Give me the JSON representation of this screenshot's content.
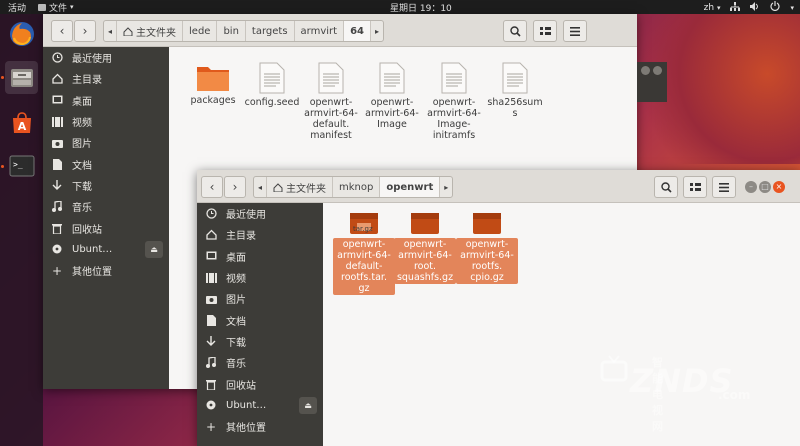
{
  "topbar": {
    "activities": "活动",
    "app_menu": "文件",
    "clock": "星期日 19：10",
    "lang": "zh"
  },
  "dock": {
    "items": [
      "firefox-icon",
      "files-icon",
      "software-icon",
      "terminal-icon"
    ]
  },
  "window1": {
    "breadcrumbs": [
      "主文件夹",
      "lede",
      "bin",
      "targets",
      "armvirt",
      "64"
    ],
    "sidebar": [
      {
        "label": "最近使用",
        "icon": "clock-icon"
      },
      {
        "label": "主目录",
        "icon": "home-icon"
      },
      {
        "label": "桌面",
        "icon": "desktop-icon"
      },
      {
        "label": "视频",
        "icon": "video-icon"
      },
      {
        "label": "图片",
        "icon": "camera-icon"
      },
      {
        "label": "文档",
        "icon": "document-icon"
      },
      {
        "label": "下载",
        "icon": "download-icon"
      },
      {
        "label": "音乐",
        "icon": "music-icon"
      },
      {
        "label": "回收站",
        "icon": "trash-icon"
      },
      {
        "label": "Ubunt…",
        "icon": "disk-icon"
      },
      {
        "label": "其他位置",
        "icon": "plus-icon"
      }
    ],
    "files": [
      {
        "name": "packages",
        "type": "folder"
      },
      {
        "name": "config.seed",
        "type": "text"
      },
      {
        "name": "openwrt-\narmvirt-64-\ndefault.\nmanifest",
        "type": "text"
      },
      {
        "name": "openwrt-\narmvirt-64-\nImage",
        "type": "text"
      },
      {
        "name": "openwrt-\narmvirt-64-\nImage-\ninitramfs",
        "type": "text"
      },
      {
        "name": "sha256sum\ns",
        "type": "text"
      }
    ]
  },
  "window2": {
    "breadcrumbs": [
      "主文件夹",
      "mknop",
      "openwrt"
    ],
    "sidebar": [
      {
        "label": "最近使用",
        "icon": "clock-icon"
      },
      {
        "label": "主目录",
        "icon": "home-icon"
      },
      {
        "label": "桌面",
        "icon": "desktop-icon"
      },
      {
        "label": "视频",
        "icon": "video-icon"
      },
      {
        "label": "图片",
        "icon": "camera-icon"
      },
      {
        "label": "文档",
        "icon": "document-icon"
      },
      {
        "label": "下载",
        "icon": "download-icon"
      },
      {
        "label": "音乐",
        "icon": "music-icon"
      },
      {
        "label": "回收站",
        "icon": "trash-icon"
      },
      {
        "label": "Ubunt…",
        "icon": "disk-icon"
      },
      {
        "label": "其他位置",
        "icon": "plus-icon"
      }
    ],
    "files": [
      {
        "name": "openwrt-\narmvirt-64-\ndefault-\nrootfs.tar.\ngz",
        "badge": "tar.gz"
      },
      {
        "name": "openwrt-\narmvirt-64-\nroot.\nsquashfs.gz",
        "badge": ""
      },
      {
        "name": "openwrt-\narmvirt-64-\nrootfs.\ncpio.gz",
        "badge": ""
      }
    ]
  },
  "watermark": {
    "brand": "ZNDS",
    "cn": "智能电视网",
    "domain": ".com"
  },
  "colors": {
    "accent": "#e95420",
    "sidebar_bg": "#3d3c38",
    "selected_label": "#e3855a"
  }
}
